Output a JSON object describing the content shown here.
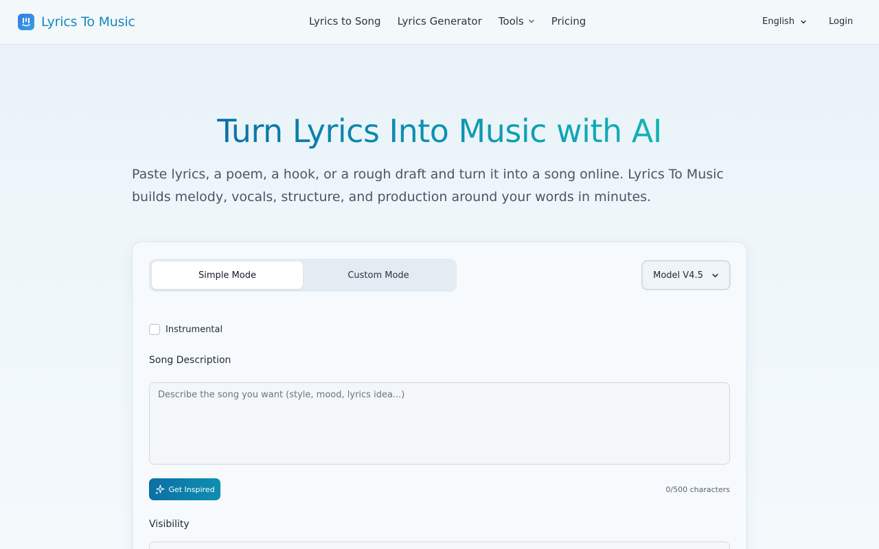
{
  "header": {
    "brand": "Lyrics To Music",
    "nav": [
      {
        "label": "Lyrics to Song"
      },
      {
        "label": "Lyrics Generator"
      },
      {
        "label": "Tools"
      },
      {
        "label": "Pricing"
      }
    ],
    "language": "English",
    "login": "Login"
  },
  "hero": {
    "title": "Turn Lyrics Into Music with AI",
    "subtitle": "Paste lyrics, a poem, a hook, or a rough draft and turn it into a song online. Lyrics To Music builds melody, vocals, structure, and production around your words in minutes."
  },
  "form": {
    "modes": [
      {
        "label": "Simple Mode",
        "active": true
      },
      {
        "label": "Custom Mode",
        "active": false
      }
    ],
    "model": "Model V4.5",
    "instrumental_label": "Instrumental",
    "instrumental_checked": false,
    "description_label": "Song Description",
    "description_placeholder": "Describe the song you want (style, mood, lyrics idea...)",
    "description_value": "",
    "inspire_label": "Get Inspired",
    "char_count": "0/500 characters",
    "visibility_label": "Visibility"
  },
  "icons": {
    "logo": "lyrics-to-music-logo",
    "tools_dropdown": "chevron-down-icon",
    "language_dropdown": "chevron-down-icon",
    "model_dropdown": "chevron-down-icon",
    "inspire": "sparkle-icon"
  },
  "colors": {
    "brand": "#1588b8",
    "accent_gradient_start": "#0a72a8",
    "accent_gradient_end": "#12b2b6",
    "button": "#0e7fab"
  }
}
